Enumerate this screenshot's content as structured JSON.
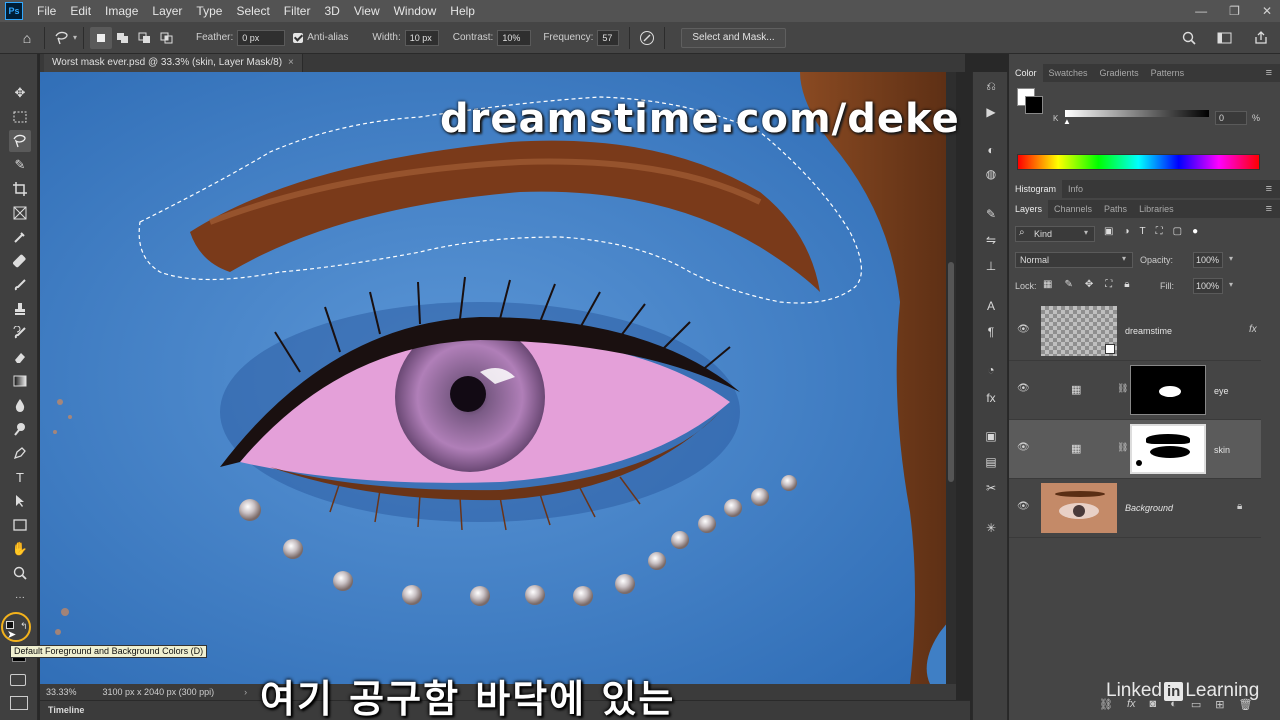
{
  "menubar": {
    "items": [
      "File",
      "Edit",
      "Image",
      "Layer",
      "Type",
      "Select",
      "Filter",
      "3D",
      "View",
      "Window",
      "Help"
    ]
  },
  "options": {
    "feather_label": "Feather:",
    "feather_value": "0 px",
    "antialias_label": "Anti-alias",
    "width_label": "Width:",
    "width_value": "10 px",
    "contrast_label": "Contrast:",
    "contrast_value": "10%",
    "frequency_label": "Frequency:",
    "frequency_value": "57",
    "select_mask_label": "Select and Mask..."
  },
  "document": {
    "tab_title": "Worst mask ever.psd @ 33.3% (skin, Layer Mask/8)",
    "close_glyph": "×"
  },
  "canvas": {
    "watermark": "dreamstime.com/deke"
  },
  "statusbar": {
    "zoom": "33.33%",
    "doc_info": "3100 px x 2040 px (300 ppi)"
  },
  "timeline": {
    "label": "Timeline"
  },
  "tooltip": {
    "text": "Default Foreground and Background Colors (D)"
  },
  "caption": {
    "text": "여기 공구함 바닥에 있는"
  },
  "branding": {
    "prefix": "Linked",
    "box": "in",
    "suffix": "Learning"
  },
  "color_panel": {
    "tabs": [
      "Color",
      "Swatches",
      "Gradients",
      "Patterns"
    ],
    "channel": "K",
    "value": "0",
    "unit": "%"
  },
  "histogram_panel": {
    "tabs": [
      "Histogram",
      "Info"
    ]
  },
  "layers_panel": {
    "tabs": [
      "Layers",
      "Channels",
      "Paths",
      "Libraries"
    ],
    "filter_kind": "Kind",
    "blend_mode": "Normal",
    "opacity_label": "Opacity:",
    "opacity_value": "100%",
    "lock_label": "Lock:",
    "fill_label": "Fill:",
    "fill_value": "100%",
    "layers": [
      {
        "name": "dreamstime"
      },
      {
        "name": "eye"
      },
      {
        "name": "skin"
      },
      {
        "name": "Background"
      }
    ]
  },
  "colors": {
    "accent": "#31a8ff",
    "canvas_blue": "#3f7fc5",
    "iris_pink": "#e4a0d9"
  }
}
